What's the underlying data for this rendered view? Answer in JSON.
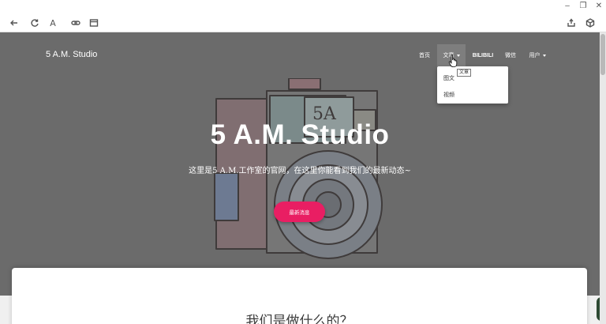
{
  "window": {
    "minimize_glyph": "–",
    "restore_glyph": "❐",
    "close_glyph": "✕"
  },
  "toolbar": {
    "back_icon": "arrow-left",
    "reload_icon": "reload",
    "reader_glyph": "A",
    "link_icon": "link",
    "tabs_icon": "window",
    "share_icon": "share",
    "extension_icon": "cube"
  },
  "site": {
    "brand": "5 A.M. Studio",
    "nav": [
      {
        "label": "首页"
      },
      {
        "label": "文章"
      },
      {
        "label": "BILIBILI"
      },
      {
        "label": "微信"
      },
      {
        "label": "用户"
      }
    ],
    "dropdown": [
      "图文",
      "视频"
    ],
    "tooltip": "文章"
  },
  "hero": {
    "title": "5 A.M. Studio",
    "subtitle": "这里是5 A.M.工作室的官网，在这里你能看到我们的最新动态~",
    "button": "最新消息",
    "button_color": "#e91e63",
    "background_color": "#6b6b6b"
  },
  "section": {
    "title": "我们是做什么的？"
  }
}
